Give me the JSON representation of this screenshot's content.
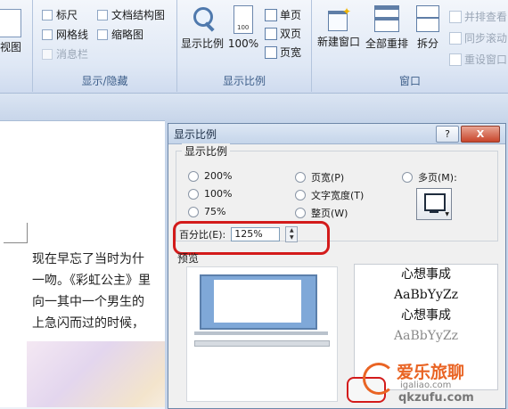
{
  "ribbon": {
    "view_fragment": "视图",
    "show_hide": {
      "items": [
        {
          "label": "标尺",
          "checked": false
        },
        {
          "label": "网格线",
          "checked": false
        },
        {
          "label": "消息栏",
          "checked": false,
          "disabled": true
        },
        {
          "label": "文档结构图",
          "checked": false
        },
        {
          "label": "缩略图",
          "checked": false
        }
      ],
      "group_label": "显示/隐藏"
    },
    "zoom": {
      "zoom_button": "显示比例",
      "hundred_button": "100%",
      "one_page": "单页",
      "two_pages": "双页",
      "page_width": "页宽",
      "group_label": "显示比例"
    },
    "window": {
      "new_window": "新建窗口",
      "arrange_all": "全部重排",
      "split": "拆分",
      "side_by_side": "并排查看",
      "sync_scroll": "同步滚动",
      "reset_position": "重设窗口",
      "group_label": "窗口"
    }
  },
  "document": {
    "lines": [
      "现在早忘了当时为什",
      "一吻。《彩虹公主》里",
      "向一其中一个男生的",
      "上急闪而过的时候，"
    ]
  },
  "dialog": {
    "title": "显示比例",
    "help": "?",
    "close": "X",
    "zoom_group": {
      "legend": "显示比例",
      "options": [
        {
          "label": "200%",
          "selected": false
        },
        {
          "label": "100%",
          "selected": false
        },
        {
          "label": "75%",
          "selected": false
        },
        {
          "label": "页宽(P)",
          "selected": false
        },
        {
          "label": "文字宽度(T)",
          "selected": false
        },
        {
          "label": "整页(W)",
          "selected": false
        },
        {
          "label": "多页(M):",
          "selected": false
        }
      ],
      "percent_label": "百分比(E):",
      "percent_value": "125%"
    },
    "preview": {
      "legend": "预览",
      "samples": [
        "心想事成",
        "AaBbYyZz",
        "心想事成",
        "AaBbYyZz"
      ]
    }
  },
  "watermark": {
    "name": "爱乐旅聊",
    "url_line1": "igaliao.com",
    "url_line2": "qkzufu.com"
  }
}
